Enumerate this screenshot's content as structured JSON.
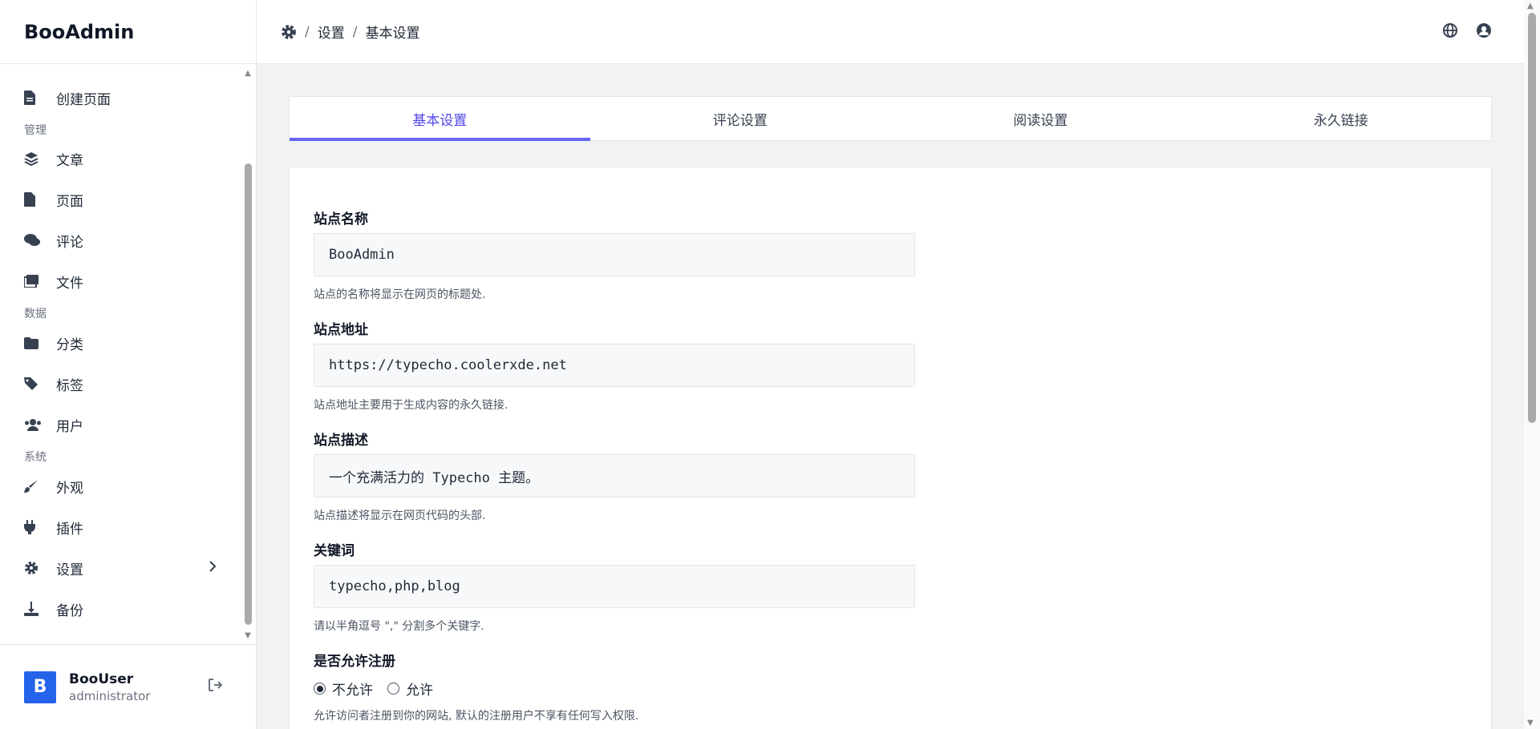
{
  "app": {
    "brand": "BooAdmin"
  },
  "sidebar": {
    "items": [
      {
        "label": "创建页面",
        "icon": "file-alt-icon"
      },
      {
        "label": "文章",
        "icon": "layers-icon"
      },
      {
        "label": "页面",
        "icon": "file-icon"
      },
      {
        "label": "评论",
        "icon": "comments-icon"
      },
      {
        "label": "文件",
        "icon": "images-icon"
      },
      {
        "label": "分类",
        "icon": "folder-icon"
      },
      {
        "label": "标签",
        "icon": "tags-icon"
      },
      {
        "label": "用户",
        "icon": "users-icon"
      },
      {
        "label": "外观",
        "icon": "paint-brush-icon"
      },
      {
        "label": "插件",
        "icon": "plug-icon"
      },
      {
        "label": "设置",
        "icon": "gear-icon"
      },
      {
        "label": "备份",
        "icon": "download-icon"
      }
    ],
    "groups": [
      "管理",
      "数据",
      "系统"
    ],
    "user": {
      "initial": "B",
      "name": "BooUser",
      "role": "administrator"
    }
  },
  "header": {
    "breadcrumb": [
      "设置",
      "基本设置"
    ]
  },
  "tabs": [
    "基本设置",
    "评论设置",
    "阅读设置",
    "永久链接"
  ],
  "form": {
    "site_name": {
      "label": "站点名称",
      "value": "BooAdmin",
      "help": "站点的名称将显示在网页的标题处."
    },
    "site_url": {
      "label": "站点地址",
      "value": "https://typecho.coolerxde.net",
      "help": "站点地址主要用于生成内容的永久链接."
    },
    "site_desc": {
      "label": "站点描述",
      "value": "一个充满活力的 Typecho 主题。",
      "help": "站点描述将显示在网页代码的头部."
    },
    "keywords": {
      "label": "关键词",
      "value": "typecho,php,blog",
      "help": "请以半角逗号 \",\" 分割多个关键字."
    },
    "register": {
      "label": "是否允许注册",
      "options": [
        "不允许",
        "允许"
      ],
      "selected": "不允许",
      "help": "允许访问者注册到你的网站, 默认的注册用户不享有任何写入权限."
    }
  },
  "colors": {
    "accent": "#6366f1",
    "avatar": "#2563eb"
  }
}
